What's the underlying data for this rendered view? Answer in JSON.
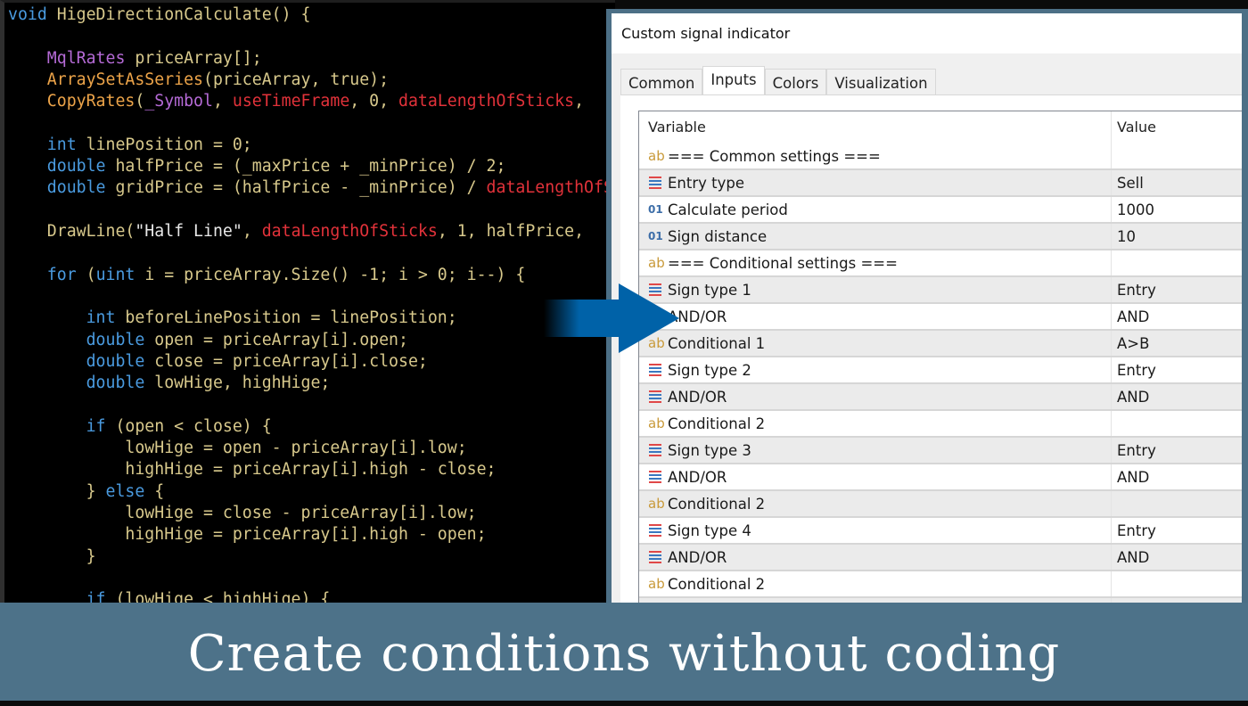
{
  "code_lines": [
    [
      [
        "void ",
        "k"
      ],
      [
        "HigeDirectionCalculate() {",
        "t"
      ]
    ],
    [],
    [
      [
        "    MqlRates ",
        "p"
      ],
      [
        "priceArray[];",
        "t"
      ]
    ],
    [
      [
        "    ArraySetAsSeries",
        "f"
      ],
      [
        "(priceArray, true);",
        "t"
      ]
    ],
    [
      [
        "    CopyRates",
        "f"
      ],
      [
        "(",
        "t"
      ],
      [
        "_Symbol",
        "p"
      ],
      [
        ", ",
        "t"
      ],
      [
        "useTimeFrame",
        "r"
      ],
      [
        ", 0, ",
        "t"
      ],
      [
        "dataLengthOfSticks",
        "r"
      ],
      [
        ",",
        "t"
      ]
    ],
    [],
    [
      [
        "    int ",
        "k"
      ],
      [
        "linePosition = 0;",
        "t"
      ]
    ],
    [
      [
        "    double ",
        "k"
      ],
      [
        "halfPrice = (_maxPrice + _minPrice) / 2;",
        "t"
      ]
    ],
    [
      [
        "    double ",
        "k"
      ],
      [
        "gridPrice = (halfPrice - _minPrice) / ",
        "t"
      ],
      [
        "dataLengthOfSticks",
        "r"
      ]
    ],
    [],
    [
      [
        "    DrawLine(",
        "t"
      ],
      [
        "\"Half Line\"",
        "w"
      ],
      [
        ", ",
        "t"
      ],
      [
        "dataLengthOfSticks",
        "r"
      ],
      [
        ", 1, halfPrice,",
        "t"
      ]
    ],
    [],
    [
      [
        "    for ",
        "k"
      ],
      [
        "(",
        "t"
      ],
      [
        "uint ",
        "k"
      ],
      [
        "i = priceArray.Size() -1; i > 0; i--) {",
        "t"
      ]
    ],
    [],
    [
      [
        "        int ",
        "k"
      ],
      [
        "beforeLinePosition = linePosition;",
        "t"
      ]
    ],
    [
      [
        "        double ",
        "k"
      ],
      [
        "open = priceArray[i].open;",
        "t"
      ]
    ],
    [
      [
        "        double ",
        "k"
      ],
      [
        "close = priceArray[i].close;",
        "t"
      ]
    ],
    [
      [
        "        double ",
        "k"
      ],
      [
        "lowHige, highHige;",
        "t"
      ]
    ],
    [],
    [
      [
        "        if ",
        "k"
      ],
      [
        "(open < close) {",
        "t"
      ]
    ],
    [
      [
        "            lowHige = open - priceArray[i].low;",
        "t"
      ]
    ],
    [
      [
        "            highHige = priceArray[i].high - close;",
        "t"
      ]
    ],
    [
      [
        "        } ",
        "t"
      ],
      [
        "else ",
        "k"
      ],
      [
        "{",
        "t"
      ]
    ],
    [
      [
        "            lowHige = close - priceArray[i].low;",
        "t"
      ]
    ],
    [
      [
        "            highHige = priceArray[i].high - open;",
        "t"
      ]
    ],
    [
      [
        "        }",
        "t"
      ]
    ],
    [],
    [
      [
        "        if ",
        "k"
      ],
      [
        "(lowHige < highHige) {",
        "t"
      ]
    ]
  ],
  "dialog": {
    "title": "Custom signal indicator",
    "tabs": [
      {
        "label": "Common"
      },
      {
        "label": "Inputs",
        "active": true
      },
      {
        "label": "Colors"
      },
      {
        "label": "Visualization"
      }
    ],
    "columns": {
      "variable": "Variable",
      "value": "Value"
    },
    "rows": [
      {
        "icon": "ab",
        "variable": "=== Common settings ===",
        "value": ""
      },
      {
        "icon": "enum",
        "variable": "Entry type",
        "value": "Sell"
      },
      {
        "icon": "01",
        "variable": "Calculate period",
        "value": "1000"
      },
      {
        "icon": "01",
        "variable": "Sign distance",
        "value": "10"
      },
      {
        "icon": "ab",
        "variable": "=== Conditional settings ===",
        "value": ""
      },
      {
        "icon": "enum",
        "variable": "Sign type 1",
        "value": "Entry"
      },
      {
        "icon": "enum",
        "variable": "AND/OR",
        "value": "AND"
      },
      {
        "icon": "ab",
        "variable": "Conditional 1",
        "value": "A>B"
      },
      {
        "icon": "enum",
        "variable": "Sign type 2",
        "value": "Entry"
      },
      {
        "icon": "enum",
        "variable": "AND/OR",
        "value": "AND"
      },
      {
        "icon": "ab",
        "variable": "Conditional 2",
        "value": ""
      },
      {
        "icon": "enum",
        "variable": "Sign type 3",
        "value": "Entry"
      },
      {
        "icon": "enum",
        "variable": "AND/OR",
        "value": "AND"
      },
      {
        "icon": "ab",
        "variable": "Conditional 2",
        "value": ""
      },
      {
        "icon": "enum",
        "variable": "Sign type 4",
        "value": "Entry"
      },
      {
        "icon": "enum",
        "variable": "AND/OR",
        "value": "AND"
      },
      {
        "icon": "ab",
        "variable": "Conditional 2",
        "value": ""
      },
      {
        "icon": "enum",
        "variable": "",
        "value": ""
      }
    ]
  },
  "banner": {
    "text": "Create conditions without coding"
  },
  "colors": {
    "banner": "#4d7289",
    "arrow": "#0062a8",
    "keyword": "#4a9be0",
    "param": "#e2323a",
    "function": "#eda449"
  }
}
